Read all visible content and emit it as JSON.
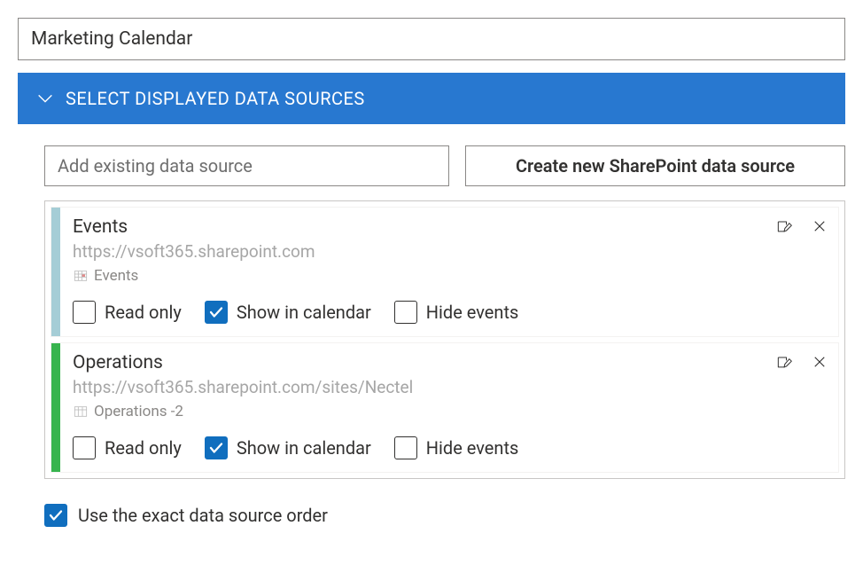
{
  "title": "Marketing Calendar",
  "sectionHeader": "SELECT DISPLAYED DATA SOURCES",
  "addSourcePlaceholder": "Add existing data source",
  "createButtonLabel": "Create new SharePoint data source",
  "checkboxLabels": {
    "readOnly": "Read only",
    "showInCalendar": "Show in calendar",
    "hideEvents": "Hide events"
  },
  "dataSources": [
    {
      "name": "Events",
      "url": "https://vsoft365.sharepoint.com",
      "subIconType": "calendar",
      "subName": "Events",
      "colorClass": "blue",
      "readOnly": false,
      "showInCalendar": true,
      "hideEvents": false
    },
    {
      "name": "Operations",
      "url": "https://vsoft365.sharepoint.com/sites/Nectel",
      "subIconType": "list",
      "subName": "Operations -2",
      "colorClass": "green",
      "readOnly": false,
      "showInCalendar": true,
      "hideEvents": false
    }
  ],
  "footerCheckbox": {
    "label": "Use the exact data source order",
    "checked": true
  }
}
